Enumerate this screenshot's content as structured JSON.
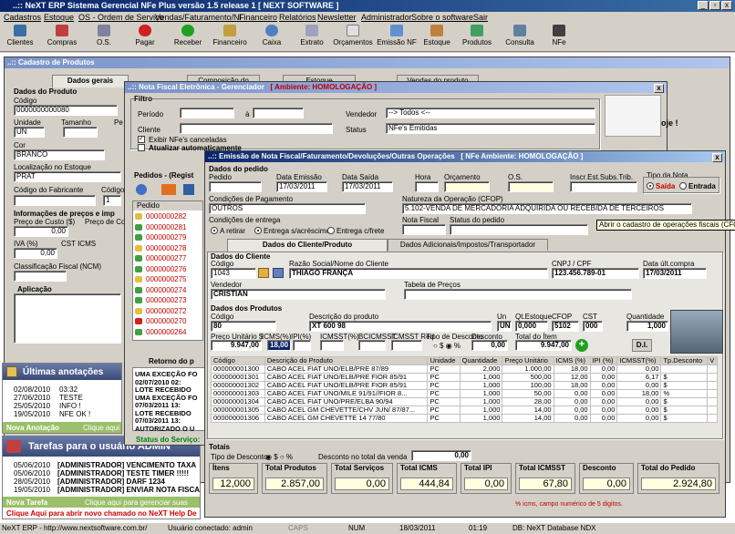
{
  "window": {
    "title": "..:: NeXT ERP Sistema Gerencial NFe Plus versão 1.5 release 1  [ NEXT SOFTWARE ]"
  },
  "menu": [
    "Cadastros",
    "Estoque",
    "OS - Ordem de Serviço",
    "Vendas/Faturamento/NF",
    "Financeiro",
    "Relatórios",
    "Newsletter",
    "Administrador",
    "Sobre o software",
    "Sair"
  ],
  "toolbar": [
    "Clientes",
    "Compras",
    "O.S.",
    "Pagar",
    "Receber",
    "Financeiro",
    "Caixa",
    "Extrato",
    "Orçamentos",
    "Emissão NF",
    "Estoque",
    "Produtos",
    "Consulta",
    "NFe"
  ],
  "colors": {
    "title_blue": "#0a246a",
    "accent_green": "#008000",
    "nova_bar": "#9bbf6a"
  },
  "produtos": {
    "title": "..:: Cadastro de Produtos",
    "tabs": [
      "Dados gerais",
      "Composição do produto",
      "Estoque",
      "Vendas do produto"
    ],
    "dados_produto": "Dados do Produto",
    "codigo_label": "Código",
    "codigo": "0000000000080",
    "unidade_label": "Unidade",
    "unidade": "UN",
    "tamanho_label": "Tamanho",
    "pe_label": "Pe",
    "cor_label": "Cor",
    "cor": "BRANCO",
    "localizacao_label": "Localização no Estoque",
    "localizacao": "PRAT",
    "fabricante_label": "Código do Fabricante",
    "codigo2_label": "Código",
    "qtd": "1",
    "info_precos": "Informações de preços e imp",
    "preco_custo_label": "Preço de Custo ($)",
    "preco_co_label": "Preço de Co",
    "preco_custo": "0,00",
    "iva_label": "IVA (%)",
    "cst_icms_label": "CST ICMS",
    "iva": "0,00",
    "ncm_label": "Classificação Fiscal (NCM)",
    "aplicacao_label": "Aplicação"
  },
  "anotacoes": {
    "title": "Últimas anotações",
    "items": [
      [
        "02/08/2010",
        "03:32"
      ],
      [
        "27/06/2010",
        "TESTE"
      ],
      [
        "25/05/2010",
        "INFO !"
      ],
      [
        "19/05/2010",
        "NFE OK !"
      ]
    ],
    "nova": "Nova Anotação",
    "link": "Clique aqui"
  },
  "tarefas": {
    "title": "Tarefas para o usuário ADMIN",
    "items": [
      [
        "05/06/2010",
        "[ADMINISTRADOR] VENCIMENTO TAXA"
      ],
      [
        "05/06/2010",
        "[ADMINISTRADOR] TESTE TIMER !!!!!"
      ],
      [
        "28/05/2010",
        "[ADMINISTRADOR] DARF 1234"
      ],
      [
        "19/05/2010",
        "[ADMINISTRADOR] ENVIAR NOTA FISCA"
      ]
    ],
    "nova": "Nova Tarefa",
    "link": "Clique aqui para gerenciar suas"
  },
  "help": "Clique Aqui para abrir novo chamado no NeXT Help De",
  "nfe_mgr": {
    "title": "..:: Nota Fiscal Eletrônica - Gerenciador",
    "ambiente": "[ Ambiente: HOMOLOGAÇÃO ]",
    "filtro": "Filtro",
    "periodo_label": "Período",
    "a_label": "à",
    "cliente_label": "Cliente",
    "vendedor_label": "Vendedor",
    "vendedor": "--> Todos <--",
    "status_label": "Status",
    "status": "NFe's Emitidas",
    "chk1": "Exibir NFe's canceladas",
    "chk2": "Atualizar automaticamente",
    "pedidos_label": "Pedidos - (Regist",
    "pedido_col": "Pedido",
    "pedidos": [
      "0000000282",
      "0000000281",
      "0000000279",
      "0000000278",
      "0000000277",
      "0000000276",
      "0000000275",
      "0000000274",
      "0000000273",
      "0000000272",
      "0000000270",
      "0000000264"
    ],
    "retorno_label": "Retorno do p",
    "retorno": [
      "UMA EXCEÇÃO FO",
      "02/07/2010 02:",
      "LOTE RECEBIDO",
      "UMA EXCEÇÃO FO",
      "07/03/2011 13:",
      "LOTE RECEBIDO",
      "07/03/2011 13:",
      "AUTORIZADO O U"
    ],
    "status_servico": "Status do Serviço:",
    "side_text": "oje !"
  },
  "emissao": {
    "title": "..:: Emissão de Nota Fiscal/Faturamento/Devoluções/Outras Operações",
    "ambiente": "[ NFe Ambiente: HOMOLOGAÇÃO ]",
    "dados_pedido": "Dados do pedido",
    "pedido_label": "Pedido",
    "data_emissao_label": "Data Emissão",
    "data_emissao": "17/03/2011",
    "data_saida_label": "Data Saída",
    "data_saida": "17/03/2011",
    "hora_label": "Hora",
    "orcamento_label": "Orçamento",
    "os_label": "O.S.",
    "inscr_label": "Inscr.Est.Subs.Trib.",
    "tipo_nota_label": "Tipo da Nota",
    "saida": "Saída",
    "entrada": "Entrada",
    "cond_pag_label": "Condições de Pagamento",
    "cond_pag": "OUTROS",
    "natureza_label": "Natureza da Operação (CFOP)",
    "natureza": "5.102-VENDA DE MERCADORIA ADQUIRIDA OU RECEBIDA DE TERCEIROS",
    "tooltip": "Abrir o cadastro de operações fiscais (CFOP)",
    "cond_entrega_label": "Condições de entrega",
    "entrega_opts": [
      "A retirar",
      "Entrega s/acréscimo",
      "Entrega c/frete"
    ],
    "nota_fiscal_label": "Nota Fiscal",
    "status_pedido_label": "Status do pedido",
    "tabs": [
      "Dados do Cliente/Produto",
      "Dados Adicionais/Impostos/Transportador"
    ],
    "dados_cliente": "Dados do Cliente",
    "cli_codigo_label": "Código",
    "cli_codigo": "1043",
    "razao_label": "Razão Social/Nome do Cliente",
    "razao": "THIAGO FRANÇA",
    "cnpj_label": "CNPJ / CPF",
    "cnpj": "123.456.789-01",
    "ult_compra_label": "Data últ.compra",
    "ult_compra": "17/03/2011",
    "vendedor_label": "Vendedor",
    "vendedor": "CRISTIAN",
    "tabela_label": "Tabela de Preços",
    "dados_produtos": "Dados dos Produtos",
    "prod_codigo_label": "Código",
    "prod_codigo": "80",
    "descricao_label": "Descrição do produto",
    "descricao": "XT 600 98",
    "un_label": "Un",
    "un": "UN",
    "qt_estoque_label": "Qt.Estoque",
    "qt_estoque": "0,000",
    "cfop_label": "CFOP",
    "cfop": "5102",
    "cst_label": "CST",
    "cst": "000",
    "quantidade_label": "Quantidade",
    "quantidade": "1,000",
    "preco_unit_label": "Preço Unitário $",
    "preco_unit": "9.947,00",
    "icms_label": "ICMS(%)",
    "icms": "18,00",
    "ipi_label": "IPI(%)",
    "icmsst_label": "ICMSST(%)",
    "bc_label": "BCICMSST",
    "icmsst_red_label": "ICMSST Red",
    "tipo_desc_label": "Tipo de Desconto",
    "desconto_label": "Desconto",
    "desconto": "0,00",
    "total_item_label": "Total do Ítem",
    "total_item": "9.947,00",
    "di": "D.I.",
    "grid_cols": [
      "Código",
      "Descrição do Produto",
      "Unidade",
      "Quantidade",
      "Preço Unitário",
      "ICMS (%)",
      "IPI (%)",
      "ICMSST(%)",
      "Tp.Desconto",
      "V"
    ],
    "grid_rows": [
      [
        "000000001300",
        "CABO ACEL FIAT UNO/ELB/PRE 87/89",
        "PC",
        "2,000",
        "1.000,00",
        "18,00",
        "0,00",
        "0,00",
        ""
      ],
      [
        "000000001301",
        "CABO ACEL FIAT UNO/ELB/PRE FIOR 85/91",
        "PC",
        "1,000",
        "500,00",
        "12,00",
        "0,00",
        "6,17",
        "$"
      ],
      [
        "000000001302",
        "CABO ACEL FIAT UNO/ELB/PRE FIOR 85/91",
        "PC",
        "1,000",
        "100,00",
        "18,00",
        "0,00",
        "0,00",
        "$"
      ],
      [
        "000000001303",
        "CABO ACEL FIAT UNO/MILE 91/91//FIOR 8...",
        "PC",
        "1,000",
        "50,00",
        "0,00",
        "0,00",
        "18,00",
        "%"
      ],
      [
        "000000001304",
        "CABO ACEL FIAT UNO/PRE/ELBA 90/94",
        "PC",
        "1,000",
        "28,00",
        "0,00",
        "0,00",
        "0,00",
        "$"
      ],
      [
        "000000001305",
        "CABO ACEL GM CHEVETTE/CHV JUN/ 87/87...",
        "PC",
        "1,000",
        "14,00",
        "0,00",
        "0,00",
        "0,00",
        "$"
      ],
      [
        "000000001306",
        "CABO ACEL GM CHEVETTE 14 77/80",
        "PC",
        "1,000",
        "14,00",
        "0,00",
        "0,00",
        "0,00",
        "$"
      ]
    ],
    "totais_label": "Totais",
    "tipo_desconto_label": "Tipo de Desconto",
    "desc_total_label": "Desconto no total da venda",
    "desc_total": "0,00",
    "totals": [
      [
        "Ítens",
        "12,000"
      ],
      [
        "Total Produtos",
        "2.857,00"
      ],
      [
        "Total Serviços",
        "0,00"
      ],
      [
        "Total ICMS",
        "444,84"
      ],
      [
        "Total IPI",
        "0,00"
      ],
      [
        "Total ICMSST",
        "67,80"
      ],
      [
        "Desconto",
        "0,00"
      ],
      [
        "Total do Pedido",
        "2.924,80"
      ]
    ],
    "hint": "% icms, campo numérico de 5 digitos."
  },
  "status": [
    "NeXT ERP - http://www.nextsoftware.com.br/",
    "Usuário conectado: admin",
    "CAPS",
    "NUM",
    "18/03/2011",
    "01:19",
    "DB: NeXT Database NDX"
  ]
}
